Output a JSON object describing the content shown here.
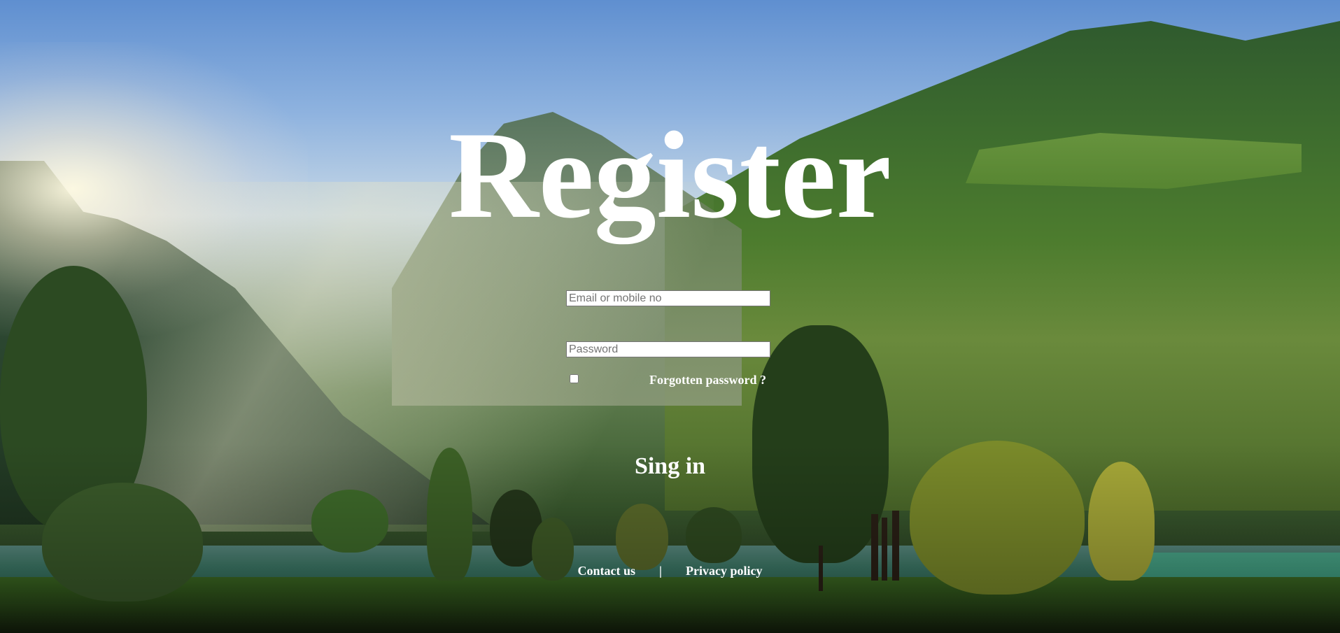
{
  "page": {
    "title": "Register"
  },
  "form": {
    "email_placeholder": "Email or mobile no",
    "email_value": "",
    "password_placeholder": "Password",
    "password_value": "",
    "remember_checked": false,
    "forgot_label": "Forgotten password ?",
    "signin_label": "Sing in"
  },
  "footer": {
    "contact_label": "Contact us",
    "separator": "|",
    "privacy_label": "Privacy policy"
  },
  "colors": {
    "text": "#ffffff",
    "sky": "#6f9bd6",
    "foliage": "#3f6e2e"
  }
}
